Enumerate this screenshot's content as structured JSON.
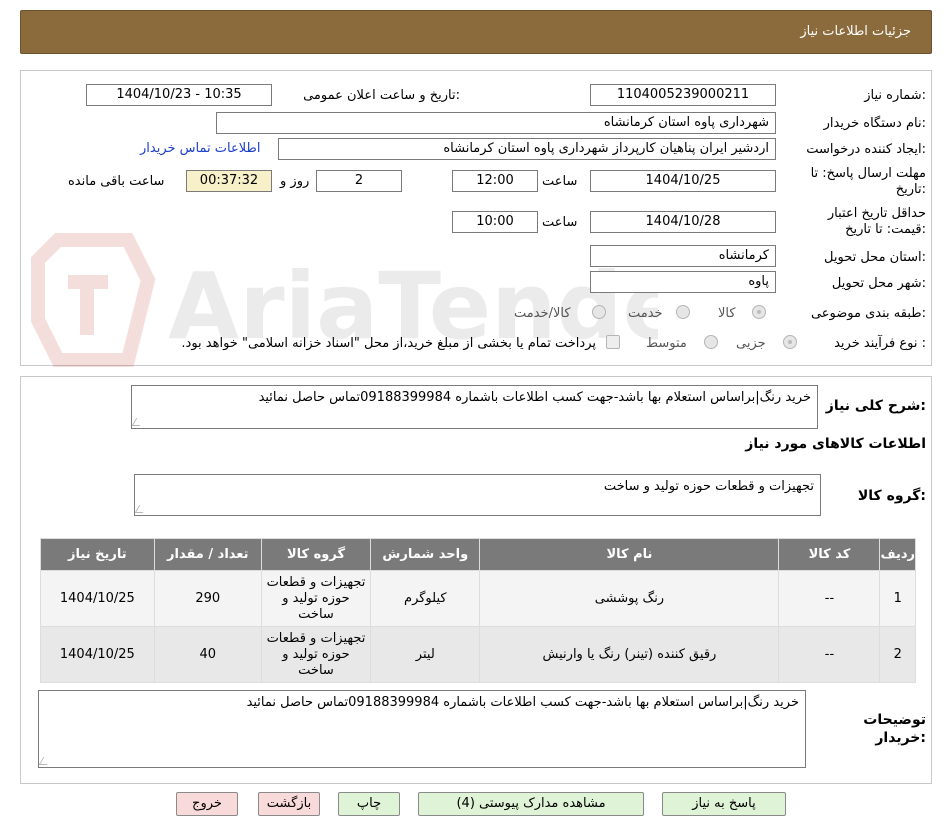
{
  "header": {
    "title": "جزئیات اطلاعات نیاز"
  },
  "watermark": {
    "text": "AriaTender.neT"
  },
  "fields": {
    "need_number_label": "شماره نیاز:",
    "need_number": "1104005239000211",
    "announce_label": "تاریخ و ساعت اعلان عمومی:",
    "announce_value": "1404/10/23 - 10:35",
    "buyer_label": "نام دستگاه خریدار:",
    "buyer_value": "شهرداری پاوه استان کرمانشاه",
    "creator_label": "ایجاد کننده درخواست:",
    "creator_value": "اردشیر ایران پناهیان کارپرداز شهرداری پاوه استان کرمانشاه",
    "contact_link": "اطلاعات تماس خریدار",
    "deadline_label_1": "مهلت ارسال پاسخ: تا",
    "deadline_label_2": "تاریخ:",
    "deadline_date": "1404/10/25",
    "time_label": "ساعت",
    "deadline_time": "12:00",
    "days_value": "2",
    "days_label": "روز و",
    "remaining_time": "00:37:32",
    "remaining_label": "ساعت باقی مانده",
    "validity_label_1": "حداقل تاریخ اعتبار",
    "validity_label_2": "قیمت: تا تاریخ:",
    "validity_date": "1404/10/28",
    "validity_time_label": "ساعت",
    "validity_time": "10:00",
    "province_label": "استان محل تحویل:",
    "province_value": "کرمانشاه",
    "city_label": "شهر محل تحویل:",
    "city_value": "پاوه",
    "category_label": "طبقه بندی موضوعی:",
    "category_options": [
      "کالا",
      "خدمت",
      "کالا/خدمت"
    ],
    "process_label": "نوع فرآیند خرید :",
    "process_options": [
      "جزیی",
      "متوسط"
    ],
    "payment_note": "پرداخت تمام یا بخشی از مبلغ خرید،از محل \"اسناد خزانه اسلامی\" خواهد بود."
  },
  "summary": {
    "label": "شرح کلی نیاز:",
    "text": "خرید رنگ|براساس استعلام بها باشد-جهت کسب اطلاعات باشماره 09188399984تماس حاصل نمائید"
  },
  "goods_section": {
    "title": "اطلاعات کالاهای مورد نیاز",
    "group_label": "گروه کالا:",
    "group_value": "تجهیزات و قطعات حوزه تولید و ساخت"
  },
  "table": {
    "headers": [
      "ردیف",
      "کد کالا",
      "نام کالا",
      "واحد شمارش",
      "گروه کالا",
      "تعداد / مقدار",
      "تاریخ نیاز"
    ],
    "rows": [
      [
        "1",
        "--",
        "رنگ پوششی",
        "کیلوگرم",
        "تجهیزات و قطعات حوزه تولید و ساخت",
        "290",
        "1404/10/25"
      ],
      [
        "2",
        "--",
        "رقیق کننده (تینر) رنگ یا وارنیش",
        "لیتر",
        "تجهیزات و قطعات حوزه تولید و ساخت",
        "40",
        "1404/10/25"
      ]
    ]
  },
  "buyer_notes": {
    "label_1": "توضیحات",
    "label_2": "خریدار:",
    "text": "خرید رنگ|براساس استعلام بها باشد-جهت کسب اطلاعات باشماره 09188399984تماس حاصل نمائید"
  },
  "buttons": {
    "reply": "پاسخ به نیاز",
    "attachments": "مشاهده مدارک پیوستی (4)",
    "print": "چاپ",
    "back": "بازگشت",
    "exit": "خروج"
  },
  "colors": {
    "header_bg": "#8b6a3c",
    "link": "#1a3ec8",
    "timer_bg": "#f7f0c8"
  }
}
